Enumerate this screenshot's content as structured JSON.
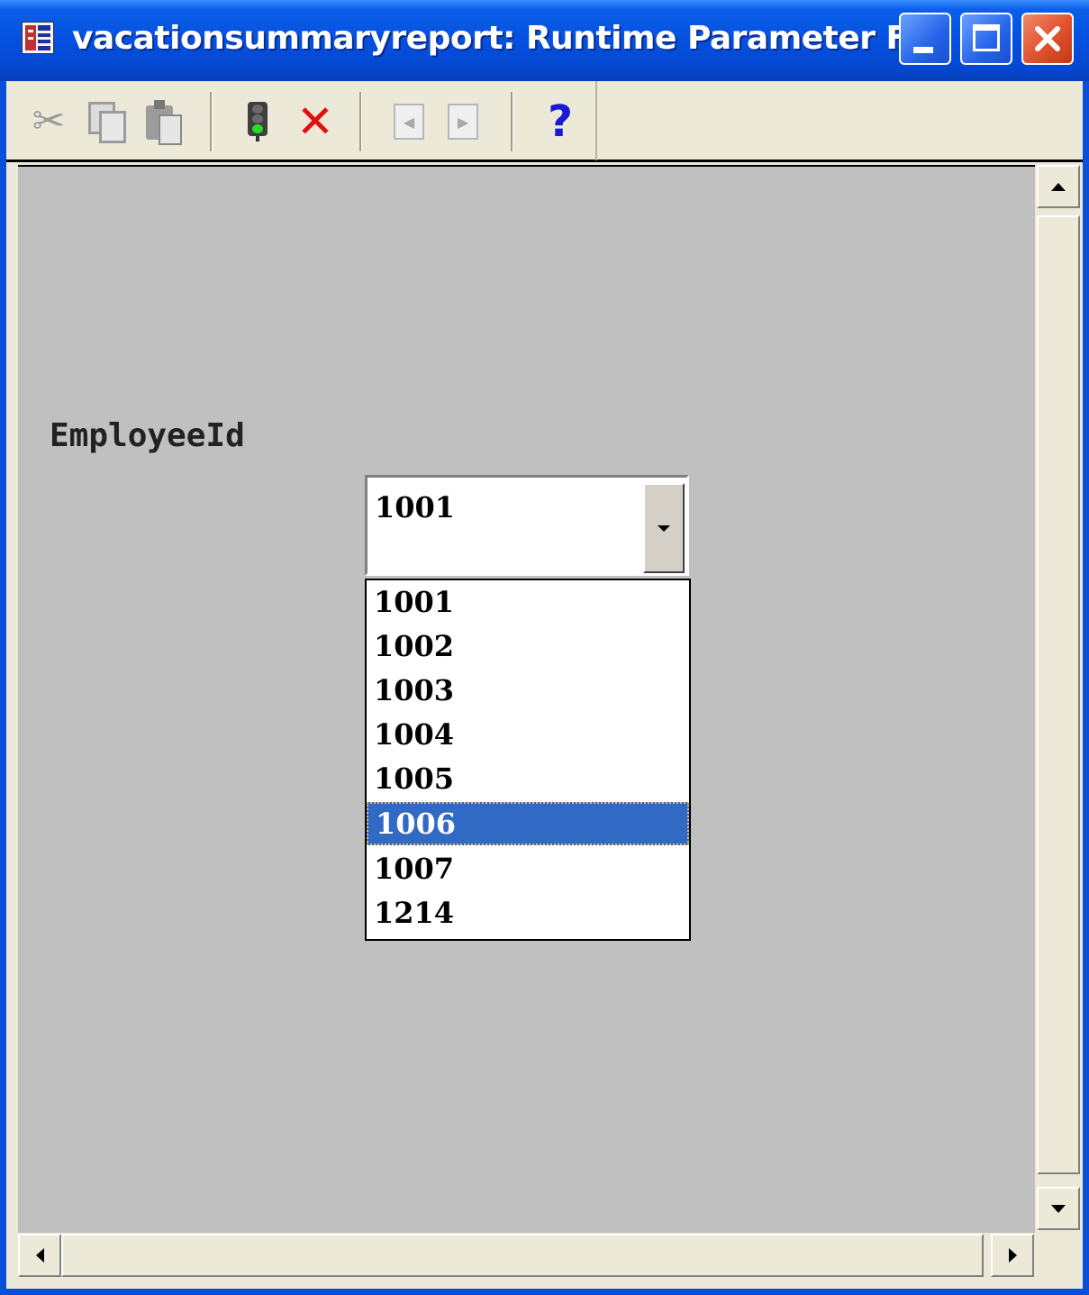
{
  "window": {
    "title": "vacationsummaryreport: Runtime Parameter F...",
    "controls": [
      "minimize",
      "maximize",
      "close"
    ],
    "colors": {
      "titlebar": "#0550e0",
      "close_button": "#e0502c",
      "canvas": "#c0c0c0",
      "selection": "#316ac5"
    }
  },
  "toolbar": {
    "items": [
      {
        "icon": "scissors-icon",
        "enabled": false
      },
      {
        "icon": "copy-icon",
        "enabled": false
      },
      {
        "icon": "paste-icon",
        "enabled": false
      },
      {
        "icon": "traffic-light-icon",
        "enabled": true
      },
      {
        "icon": "cancel-x-icon",
        "enabled": true
      },
      {
        "icon": "previous-icon",
        "enabled": false
      },
      {
        "icon": "next-icon",
        "enabled": false
      },
      {
        "icon": "help-icon",
        "enabled": true
      }
    ]
  },
  "form": {
    "parameter_label": "EmployeeId",
    "combo": {
      "value": "1001",
      "options": [
        "1001",
        "1002",
        "1003",
        "1004",
        "1005",
        "1006",
        "1007",
        "1214"
      ],
      "highlighted": "1006"
    }
  }
}
